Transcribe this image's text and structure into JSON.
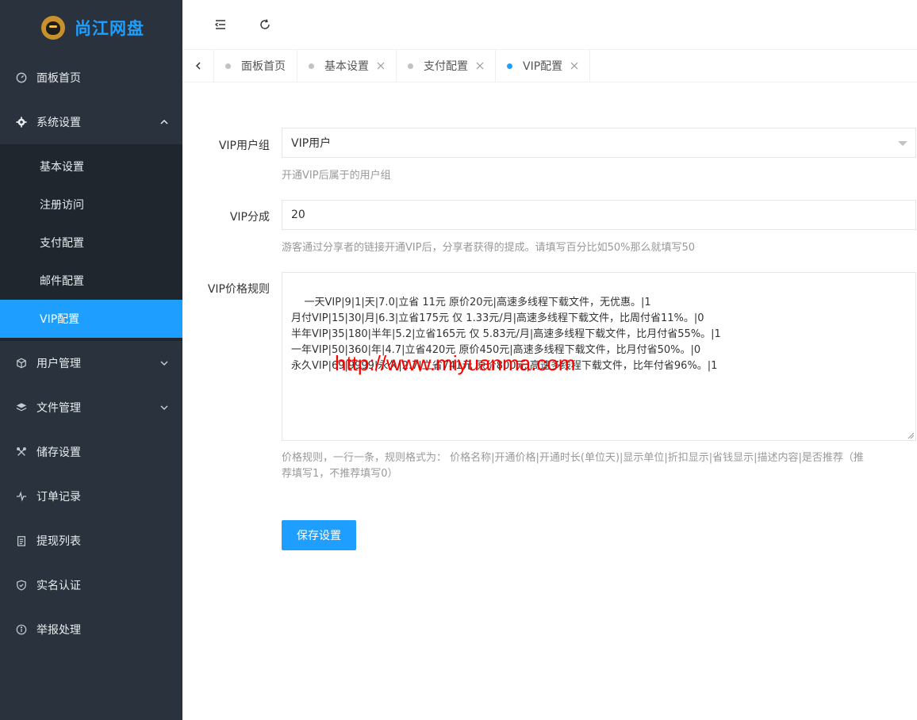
{
  "brand": {
    "name": "尚江网盘"
  },
  "sidebar": {
    "items": [
      {
        "label": "面板首页"
      },
      {
        "label": "系统设置"
      },
      {
        "label": "用户管理"
      },
      {
        "label": "文件管理"
      },
      {
        "label": "储存设置"
      },
      {
        "label": "订单记录"
      },
      {
        "label": "提现列表"
      },
      {
        "label": "实名认证"
      },
      {
        "label": "举报处理"
      }
    ],
    "sub_items": [
      {
        "label": "基本设置"
      },
      {
        "label": "注册访问"
      },
      {
        "label": "支付配置"
      },
      {
        "label": "邮件配置"
      },
      {
        "label": "VIP配置"
      }
    ]
  },
  "tabs": [
    {
      "label": "面板首页"
    },
    {
      "label": "基本设置"
    },
    {
      "label": "支付配置"
    },
    {
      "label": "VIP配置"
    }
  ],
  "form": {
    "group": {
      "label": "VIP用户组",
      "value": "VIP用户",
      "hint": "开通VIP后属于的用户组"
    },
    "share": {
      "label": "VIP分成",
      "value": "20",
      "hint": "游客通过分享者的链接开通VIP后，分享者获得的提成。请填写百分比如50%那么就填写50"
    },
    "rules": {
      "label": "VIP价格规则",
      "value": "一天VIP|9|1|天|7.0|立省 11元 原价20元|高速多线程下载文件，无优惠。|1\n月付VIP|15|30|月|6.3|立省175元 仅 1.33元/月|高速多线程下载文件，比周付省11%。|0\n半年VIP|35|180|半年|5.2|立省165元 仅 5.83元/月|高速多线程下载文件，比月付省55%。|1\n一年VIP|50|360|年|4.7|立省420元 原价450元|高速多线程下载文件，比月付省50%。|0\n永久VIP|69|9999|永久|2.7|立省741元 原价800元|高速多线程下载文件，比年付省96%。|1",
      "hint_line1": "价格规则，一行一条，规则格式为： 价格名称|开通价格|开通时长(单位天)|显示单位|折扣显示|省钱显示|描述内容|是否推荐（推",
      "hint_line2": "荐填写1，不推荐填写0）"
    },
    "save_label": "保存设置"
  },
  "watermark": "http://www.miyuanma.com",
  "colors": {
    "accent": "#1e9fff",
    "sidebar_bg": "#2a333d",
    "sidebar_sub_bg": "#1f262d",
    "watermark": "#ff0000"
  }
}
